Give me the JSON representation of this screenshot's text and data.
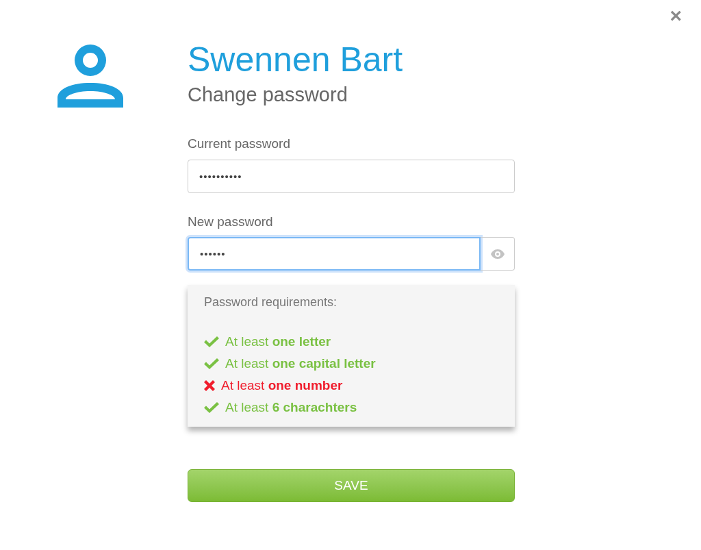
{
  "close": {
    "label": "×"
  },
  "user_name": "Swennen Bart",
  "subtitle": "Change password",
  "fields": [
    {
      "label": "Current password",
      "value": "••••••••••",
      "focused": false,
      "reveal_button": false
    },
    {
      "label": "New password",
      "value": "••••••",
      "focused": true,
      "reveal_button": true
    }
  ],
  "requirements": {
    "title": "Password requirements:",
    "items": [
      {
        "text": "At least **one letter**",
        "met": true
      },
      {
        "text": "At least **one capital letter**",
        "met": true
      },
      {
        "text": "At least **one number**",
        "met": false
      },
      {
        "text": "At least **6 charachters**",
        "met": true
      }
    ]
  },
  "save_button": "SAVE"
}
